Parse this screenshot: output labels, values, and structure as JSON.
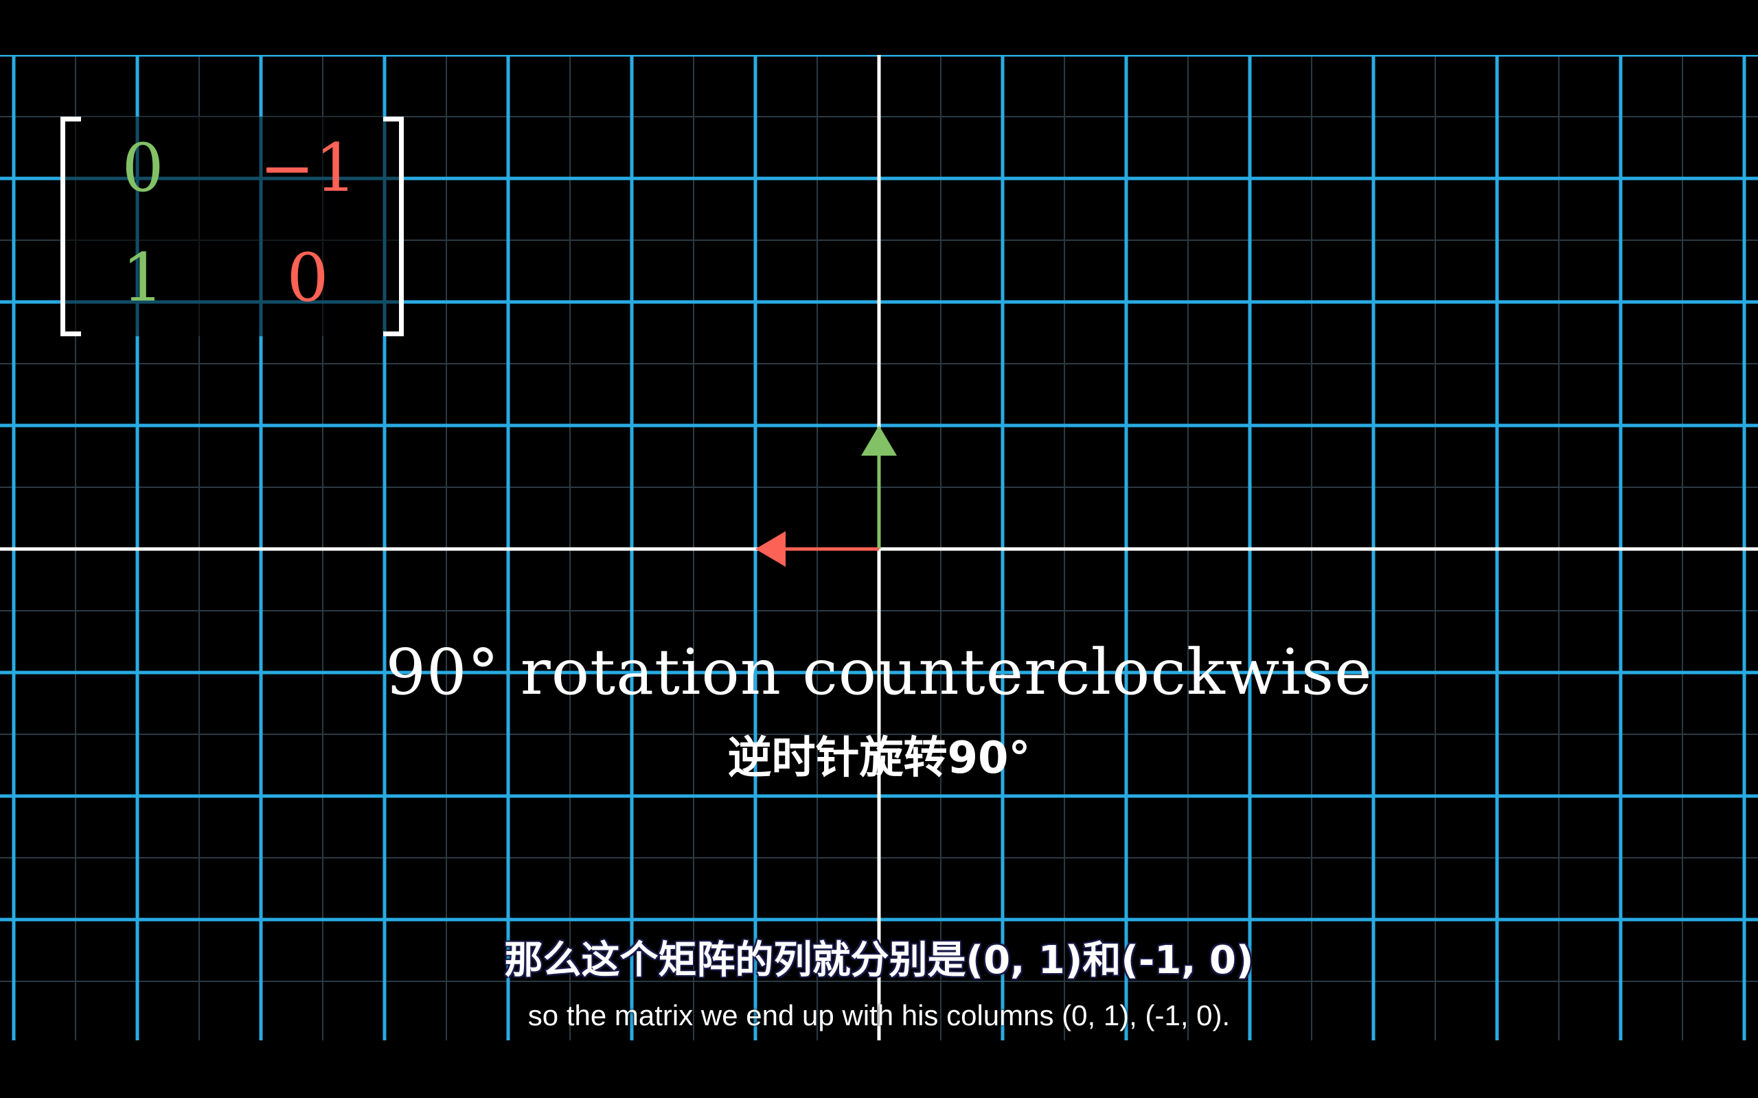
{
  "colors": {
    "grid_major": "#29abe2",
    "grid_minor": "#2a3a44",
    "axis": "#ffffff",
    "i_hat": "#83c167",
    "j_hat": "#fc6255",
    "background": "#000000"
  },
  "matrix": {
    "col1": [
      "0",
      "1"
    ],
    "col2": [
      "−1",
      "0"
    ]
  },
  "labels": {
    "title_en": "90° rotation counterclockwise",
    "title_zh": "逆时针旋转90°"
  },
  "subtitles": {
    "zh": "那么这个矩阵的列就分别是(0, 1)和(-1, 0)",
    "en": "so the matrix we end up with his columns (0, 1), (-1, 0)."
  },
  "vectors": [
    {
      "name": "i_hat",
      "x": 0,
      "y": 1,
      "color": "#83c167"
    },
    {
      "name": "j_hat",
      "x": -1,
      "y": 0,
      "color": "#fc6255"
    }
  ]
}
